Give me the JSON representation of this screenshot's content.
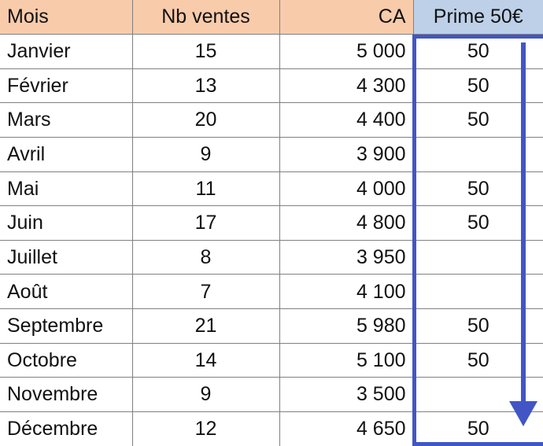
{
  "table": {
    "columns": [
      {
        "key": "mois",
        "label": "Mois",
        "align": "left"
      },
      {
        "key": "nb",
        "label": "Nb ventes",
        "align": "center"
      },
      {
        "key": "ca",
        "label": "CA",
        "align": "right"
      },
      {
        "key": "prime",
        "label": "Prime 50€",
        "align": "center"
      }
    ],
    "rows": [
      {
        "mois": "Janvier",
        "nb": "15",
        "ca": "5 000",
        "prime": "50"
      },
      {
        "mois": "Février",
        "nb": "13",
        "ca": "4 300",
        "prime": "50"
      },
      {
        "mois": "Mars",
        "nb": "20",
        "ca": "4 400",
        "prime": "50"
      },
      {
        "mois": "Avril",
        "nb": "9",
        "ca": "3 900",
        "prime": ""
      },
      {
        "mois": "Mai",
        "nb": "11",
        "ca": "4 000",
        "prime": "50"
      },
      {
        "mois": "Juin",
        "nb": "17",
        "ca": "4 800",
        "prime": "50"
      },
      {
        "mois": "Juillet",
        "nb": "8",
        "ca": "3 950",
        "prime": ""
      },
      {
        "mois": "Août",
        "nb": "7",
        "ca": "4 100",
        "prime": ""
      },
      {
        "mois": "Septembre",
        "nb": "21",
        "ca": "5 980",
        "prime": "50"
      },
      {
        "mois": "Octobre",
        "nb": "14",
        "ca": "5 100",
        "prime": "50"
      },
      {
        "mois": "Novembre",
        "nb": "9",
        "ca": "3 500",
        "prime": ""
      },
      {
        "mois": "Décembre",
        "nb": "12",
        "ca": "4 650",
        "prime": "50"
      }
    ]
  },
  "annotations": {
    "selection_column": "Prime 50€",
    "arrow": {
      "name": "down-arrow-icon",
      "direction": "down",
      "color": "#4156c4"
    }
  },
  "colors": {
    "header_fill": "#f8cbab",
    "header_fill_selected": "#bdd0e8",
    "selection_border": "#4156c4",
    "grid_line": "#808080",
    "text": "#111111",
    "cell_fill": "#ffffff"
  }
}
